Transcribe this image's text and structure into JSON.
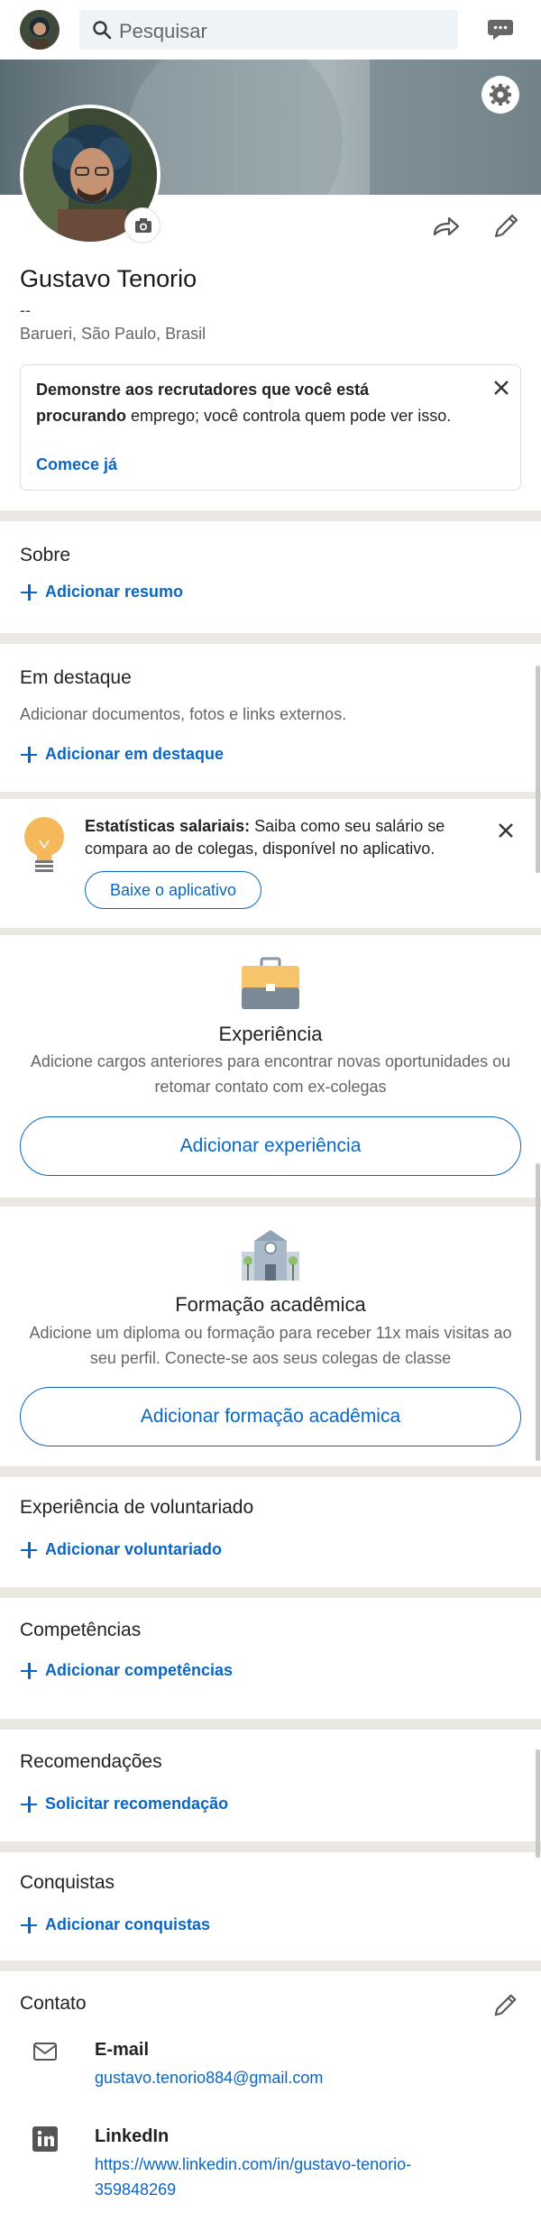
{
  "topbar": {
    "search_placeholder": "Pesquisar",
    "icons": [
      "avatar",
      "search-icon",
      "messaging-icon"
    ]
  },
  "profile": {
    "name": "Gustavo Tenorio",
    "headline": "--",
    "location": "Barueri, São Paulo, Brasil",
    "recruiter_bold": "Demonstre aos recrutadores que você está procurando",
    "recruiter_rest": " emprego; você controla quem pode ver isso.",
    "recruiter_cta": "Comece já"
  },
  "about": {
    "title": "Sobre",
    "add": "Adicionar resumo"
  },
  "featured": {
    "title": "Em destaque",
    "desc": "Adicionar documentos, fotos e links externos.",
    "add": "Adicionar em destaque"
  },
  "salary": {
    "bold": "Estatísticas salariais:",
    "text": " Saiba como seu salário se compara ao de colegas, disponível no aplicativo.",
    "button": "Baixe o aplicativo"
  },
  "experience": {
    "title": "Experiência",
    "desc": "Adicione cargos anteriores para encontrar novas oportunidades ou retomar contato com ex-colegas",
    "button": "Adicionar experiência"
  },
  "education": {
    "title": "Formação acadêmica",
    "desc": "Adicione um diploma ou formação para receber 11x mais visitas ao seu perfil. Conecte-se aos seus colegas de classe",
    "button": "Adicionar formação acadêmica"
  },
  "volunteer": {
    "title": "Experiência de voluntariado",
    "add": "Adicionar voluntariado"
  },
  "skills": {
    "title": "Competências",
    "add": "Adicionar competências"
  },
  "recommendations": {
    "title": "Recomendações",
    "add": "Solicitar recomendação"
  },
  "accomplishments": {
    "title": "Conquistas",
    "add": "Adicionar conquistas"
  },
  "contact": {
    "title": "Contato",
    "email_label": "E-mail",
    "email_value": "gustavo.tenorio884@gmail.com",
    "linkedin_label": "LinkedIn",
    "linkedin_value": "https://www.linkedin.com/in/gustavo-tenorio-359848269"
  },
  "colors": {
    "accent": "#0a66c2",
    "divider": "#ebe8e2"
  }
}
